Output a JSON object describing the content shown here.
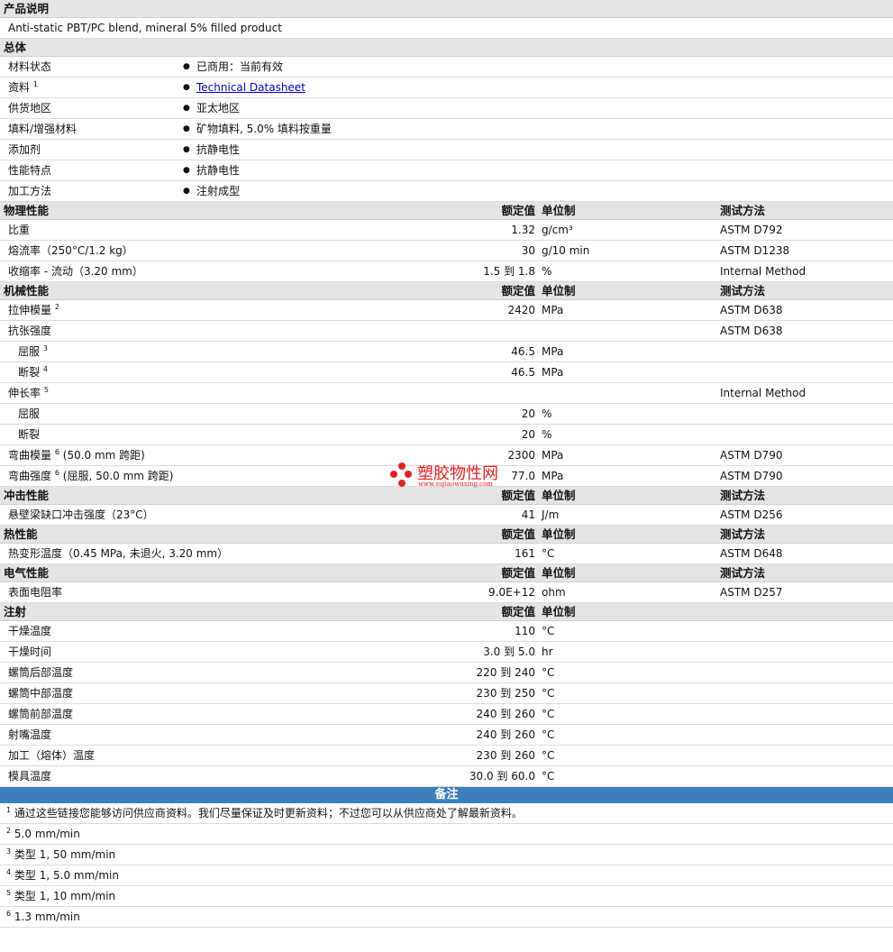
{
  "product": {
    "title": "产品说明",
    "description": "Anti-static PBT/PC blend, mineral 5% filled product"
  },
  "general": {
    "title": "总体",
    "rows": [
      {
        "label": "材料状态",
        "sup": "",
        "value": "已商用：当前有效",
        "link": false
      },
      {
        "label": "资料",
        "sup": "1",
        "value": "Technical Datasheet",
        "link": true
      },
      {
        "label": "供货地区",
        "sup": "",
        "value": "亚太地区",
        "link": false
      },
      {
        "label": "填料/增强材料",
        "sup": "",
        "value": "矿物填料, 5.0% 填料按重量",
        "link": false
      },
      {
        "label": "添加剂",
        "sup": "",
        "value": "抗静电性",
        "link": false
      },
      {
        "label": "性能特点",
        "sup": "",
        "value": "抗静电性",
        "link": false
      },
      {
        "label": "加工方法",
        "sup": "",
        "value": "注射成型",
        "link": false
      }
    ]
  },
  "headers": {
    "value": "额定值",
    "unit": "单位制",
    "method": "测试方法"
  },
  "sections": [
    {
      "title": "物理性能",
      "show_method": true,
      "rows": [
        {
          "label": "比重",
          "sup": "",
          "suffix": "",
          "value": "1.32",
          "unit": "g/cm³",
          "method": "ASTM D792",
          "indent": false
        },
        {
          "label": "熔流率（250°C/1.2 kg）",
          "sup": "",
          "suffix": "",
          "value": "30",
          "unit": "g/10 min",
          "method": "ASTM D1238",
          "indent": false
        },
        {
          "label": "收缩率 - 流动（3.20 mm）",
          "sup": "",
          "suffix": "",
          "value": "1.5 到 1.8",
          "unit": "%",
          "method": "Internal Method",
          "indent": false
        }
      ]
    },
    {
      "title": "机械性能",
      "show_method": true,
      "rows": [
        {
          "label": "拉伸模量",
          "sup": "2",
          "suffix": "",
          "value": "2420",
          "unit": "MPa",
          "method": "ASTM D638",
          "indent": false
        },
        {
          "label": "抗张强度",
          "sup": "",
          "suffix": "",
          "value": "",
          "unit": "",
          "method": "ASTM D638",
          "indent": false
        },
        {
          "label": "屈服",
          "sup": "3",
          "suffix": "",
          "value": "46.5",
          "unit": "MPa",
          "method": "",
          "indent": true
        },
        {
          "label": "断裂",
          "sup": "4",
          "suffix": "",
          "value": "46.5",
          "unit": "MPa",
          "method": "",
          "indent": true
        },
        {
          "label": "伸长率",
          "sup": "5",
          "suffix": "",
          "value": "",
          "unit": "",
          "method": "Internal Method",
          "indent": false
        },
        {
          "label": "屈服",
          "sup": "",
          "suffix": "",
          "value": "20",
          "unit": "%",
          "method": "",
          "indent": true
        },
        {
          "label": "断裂",
          "sup": "",
          "suffix": "",
          "value": "20",
          "unit": "%",
          "method": "",
          "indent": true
        },
        {
          "label": "弯曲模量",
          "sup": "6",
          "suffix": "(50.0 mm 跨距)",
          "value": "2300",
          "unit": "MPa",
          "method": "ASTM D790",
          "indent": false
        },
        {
          "label": "弯曲强度",
          "sup": "6",
          "suffix": "(屈服, 50.0 mm 跨距)",
          "value": "77.0",
          "unit": "MPa",
          "method": "ASTM D790",
          "indent": false
        }
      ]
    },
    {
      "title": "冲击性能",
      "show_method": true,
      "rows": [
        {
          "label": "悬壁梁缺口冲击强度（23°C）",
          "sup": "",
          "suffix": "",
          "value": "41",
          "unit": "J/m",
          "method": "ASTM D256",
          "indent": false
        }
      ]
    },
    {
      "title": "热性能",
      "show_method": true,
      "rows": [
        {
          "label": "热变形温度（0.45 MPa, 未退火, 3.20 mm）",
          "sup": "",
          "suffix": "",
          "value": "161",
          "unit": "°C",
          "method": "ASTM D648",
          "indent": false
        }
      ]
    },
    {
      "title": "电气性能",
      "show_method": true,
      "rows": [
        {
          "label": "表面电阻率",
          "sup": "",
          "suffix": "",
          "value": "9.0E+12",
          "unit": "ohm",
          "method": "ASTM D257",
          "indent": false
        }
      ]
    },
    {
      "title": "注射",
      "show_method": false,
      "rows": [
        {
          "label": "干燥温度",
          "sup": "",
          "suffix": "",
          "value": "110",
          "unit": "°C",
          "method": "",
          "indent": false
        },
        {
          "label": "干燥时间",
          "sup": "",
          "suffix": "",
          "value": "3.0 到 5.0",
          "unit": "hr",
          "method": "",
          "indent": false
        },
        {
          "label": "螺筒后部温度",
          "sup": "",
          "suffix": "",
          "value": "220 到 240",
          "unit": "°C",
          "method": "",
          "indent": false
        },
        {
          "label": "螺筒中部温度",
          "sup": "",
          "suffix": "",
          "value": "230 到 250",
          "unit": "°C",
          "method": "",
          "indent": false
        },
        {
          "label": "螺筒前部温度",
          "sup": "",
          "suffix": "",
          "value": "240 到 260",
          "unit": "°C",
          "method": "",
          "indent": false
        },
        {
          "label": "射嘴温度",
          "sup": "",
          "suffix": "",
          "value": "240 到 260",
          "unit": "°C",
          "method": "",
          "indent": false
        },
        {
          "label": "加工（熔体）温度",
          "sup": "",
          "suffix": "",
          "value": "230 到 260",
          "unit": "°C",
          "method": "",
          "indent": false
        },
        {
          "label": "模具温度",
          "sup": "",
          "suffix": "",
          "value": "30.0 到 60.0",
          "unit": "°C",
          "method": "",
          "indent": false
        }
      ]
    }
  ],
  "notes": {
    "title": "备注",
    "items": [
      {
        "num": "1",
        "text": "通过这些链接您能够访问供应商资料。我们尽量保证及时更新资料；不过您可以从供应商处了解最新资料。"
      },
      {
        "num": "2",
        "text": "5.0 mm/min"
      },
      {
        "num": "3",
        "text": "类型 1, 50 mm/min"
      },
      {
        "num": "4",
        "text": "类型 1, 5.0 mm/min"
      },
      {
        "num": "5",
        "text": "类型 1, 10 mm/min"
      },
      {
        "num": "6",
        "text": "1.3 mm/min"
      }
    ]
  },
  "watermark": {
    "name": "塑胶物性网",
    "url": "www.sujiaowuxing.com",
    "color": "#e8201f"
  },
  "colors": {
    "section_bg": "#e4e4e4",
    "notes_bg": "#3f7fb9",
    "link": "#0000cc"
  }
}
